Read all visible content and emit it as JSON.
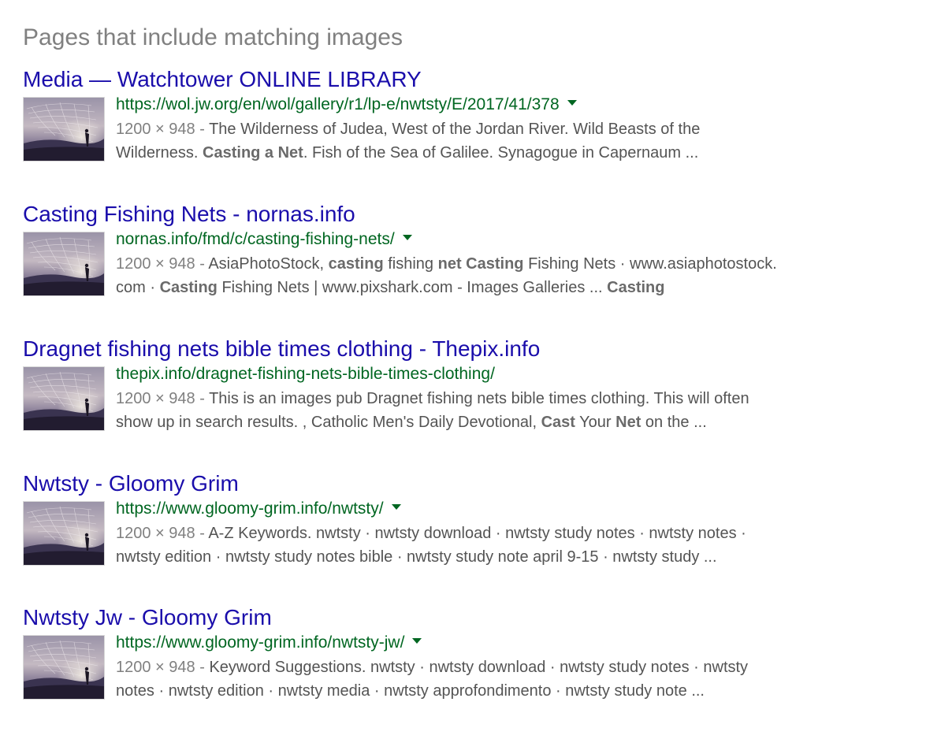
{
  "heading": "Pages that include matching images",
  "results": [
    {
      "title": "Media — Watchtower ONLINE LIBRARY",
      "url": "https://wol.jw.org/en/wol/gallery/r1/lp-e/nwtsty/E/2017/41/378",
      "has_caret": true,
      "dimensions": "1200 × 948 - ",
      "snippet_lines": [
        [
          {
            "text": "The Wilderness of Judea, West of the Jordan River. Wild Beasts of the",
            "bold": false
          }
        ],
        [
          {
            "text": "Wilderness. ",
            "bold": false
          },
          {
            "text": "Casting a Net",
            "bold": true
          },
          {
            "text": ". Fish of the Sea of Galilee. Synagogue in Capernaum  ...",
            "bold": false
          }
        ]
      ]
    },
    {
      "title": "Casting Fishing Nets - nornas.info",
      "url": "nornas.info/fmd/c/casting-fishing-nets/",
      "has_caret": true,
      "dimensions": "1200 × 948 - ",
      "snippet_lines": [
        [
          {
            "text": "AsiaPhotoStock, ",
            "bold": false
          },
          {
            "text": "casting",
            "bold": true
          },
          {
            "text": " fishing ",
            "bold": false
          },
          {
            "text": "net Casting",
            "bold": true
          },
          {
            "text": " Fishing Nets · www.asiaphotostock.",
            "bold": false
          }
        ],
        [
          {
            "text": "com · ",
            "bold": false
          },
          {
            "text": "Casting",
            "bold": true
          },
          {
            "text": " Fishing Nets | www.pixshark.com - Images Galleries ... ",
            "bold": false
          },
          {
            "text": "Casting",
            "bold": true
          }
        ]
      ]
    },
    {
      "title": "Dragnet fishing nets bible times clothing - Thepix.info",
      "url": "thepix.info/dragnet-fishing-nets-bible-times-clothing/",
      "has_caret": false,
      "dimensions": "1200 × 948 - ",
      "snippet_lines": [
        [
          {
            "text": "This is an images pub Dragnet fishing nets bible times clothing. This will often",
            "bold": false
          }
        ],
        [
          {
            "text": "show up in search results. , Catholic Men's Daily Devotional, ",
            "bold": false
          },
          {
            "text": "Cast",
            "bold": true
          },
          {
            "text": " Your ",
            "bold": false
          },
          {
            "text": "Net",
            "bold": true
          },
          {
            "text": " on the ...",
            "bold": false
          }
        ]
      ]
    },
    {
      "title": "Nwtsty - Gloomy Grim",
      "url": "https://www.gloomy-grim.info/nwtsty/",
      "has_caret": true,
      "dimensions": "1200 × 948 - ",
      "snippet_lines": [
        [
          {
            "text": "A-Z Keywords. nwtsty · nwtsty download · nwtsty study notes · nwtsty notes ·",
            "bold": false
          }
        ],
        [
          {
            "text": "nwtsty edition · nwtsty study notes bible · nwtsty study note april 9-15 · nwtsty study ...",
            "bold": false
          }
        ]
      ]
    },
    {
      "title": "Nwtsty Jw - Gloomy Grim",
      "url": "https://www.gloomy-grim.info/nwtsty-jw/",
      "has_caret": true,
      "dimensions": "1200 × 948 - ",
      "snippet_lines": [
        [
          {
            "text": "Keyword Suggestions. nwtsty · nwtsty download · nwtsty study notes · nwtsty",
            "bold": false
          }
        ],
        [
          {
            "text": "notes · nwtsty edition · nwtsty media · nwtsty approfondimento · nwtsty study note  ...",
            "bold": false
          }
        ]
      ]
    }
  ],
  "thumbnail_icon": "fishing-net-photo-thumbnail",
  "colors": {
    "title_link": "#1a0dab",
    "url_green": "#006621",
    "snippet_gray": "#545454",
    "heading_gray": "#808080"
  }
}
